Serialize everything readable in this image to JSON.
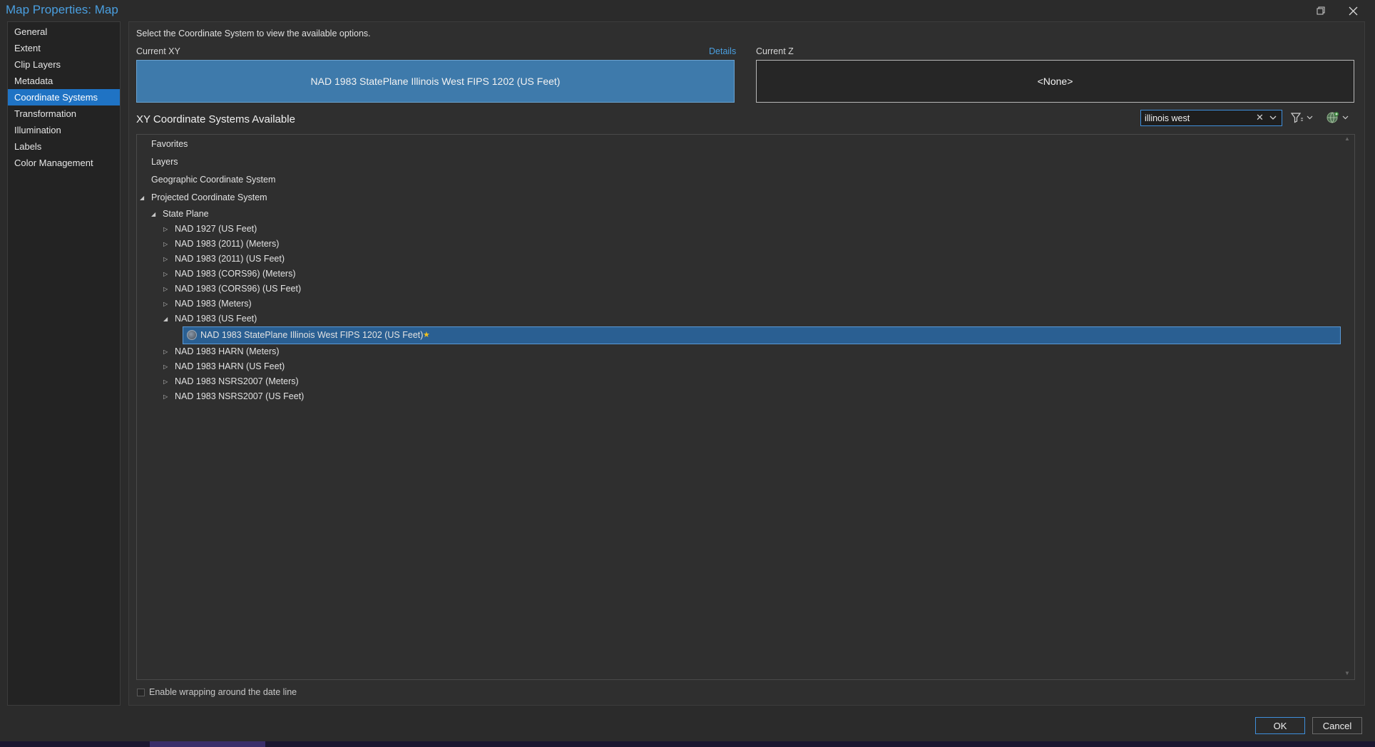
{
  "window": {
    "title": "Map Properties: Map",
    "restore_icon": "restore-icon",
    "close_icon": "close-icon"
  },
  "nav": {
    "items": [
      {
        "label": "General"
      },
      {
        "label": "Extent"
      },
      {
        "label": "Clip Layers"
      },
      {
        "label": "Metadata"
      },
      {
        "label": "Coordinate Systems",
        "active": true
      },
      {
        "label": "Transformation"
      },
      {
        "label": "Illumination"
      },
      {
        "label": "Labels"
      },
      {
        "label": "Color Management"
      }
    ]
  },
  "main": {
    "intro": "Select the Coordinate System to view the available options.",
    "current_xy_label": "Current XY",
    "details_link": "Details",
    "current_xy_value": "NAD 1983 StatePlane Illinois West FIPS 1202 (US Feet)",
    "current_z_label": "Current Z",
    "current_z_value": "<None>",
    "available_label": "XY Coordinate Systems Available",
    "search_value": "illinois west",
    "wrap_checkbox_label": "Enable wrapping around the date line",
    "wrap_checked": false
  },
  "tree": {
    "root": [
      "Favorites",
      "Layers",
      "Geographic Coordinate System"
    ],
    "projected": "Projected Coordinate System",
    "state_plane": "State Plane",
    "groups": [
      "NAD 1927 (US Feet)",
      "NAD 1983 (2011) (Meters)",
      "NAD 1983 (2011) (US Feet)",
      "NAD 1983 (CORS96) (Meters)",
      "NAD 1983 (CORS96) (US Feet)",
      "NAD 1983 (Meters)",
      "NAD 1983 (US Feet)"
    ],
    "selected_item": "NAD 1983 StatePlane Illinois West FIPS 1202 (US Feet)",
    "groups_after": [
      "NAD 1983 HARN (Meters)",
      "NAD 1983 HARN (US Feet)",
      "NAD 1983 NSRS2007 (Meters)",
      "NAD 1983 NSRS2007 (US Feet)"
    ]
  },
  "buttons": {
    "ok": "OK",
    "cancel": "Cancel"
  },
  "colors": {
    "accent": "#1f73c4",
    "link": "#4a9fe0",
    "selection": "#2a5f92",
    "favorite_star": "#f0c020"
  }
}
